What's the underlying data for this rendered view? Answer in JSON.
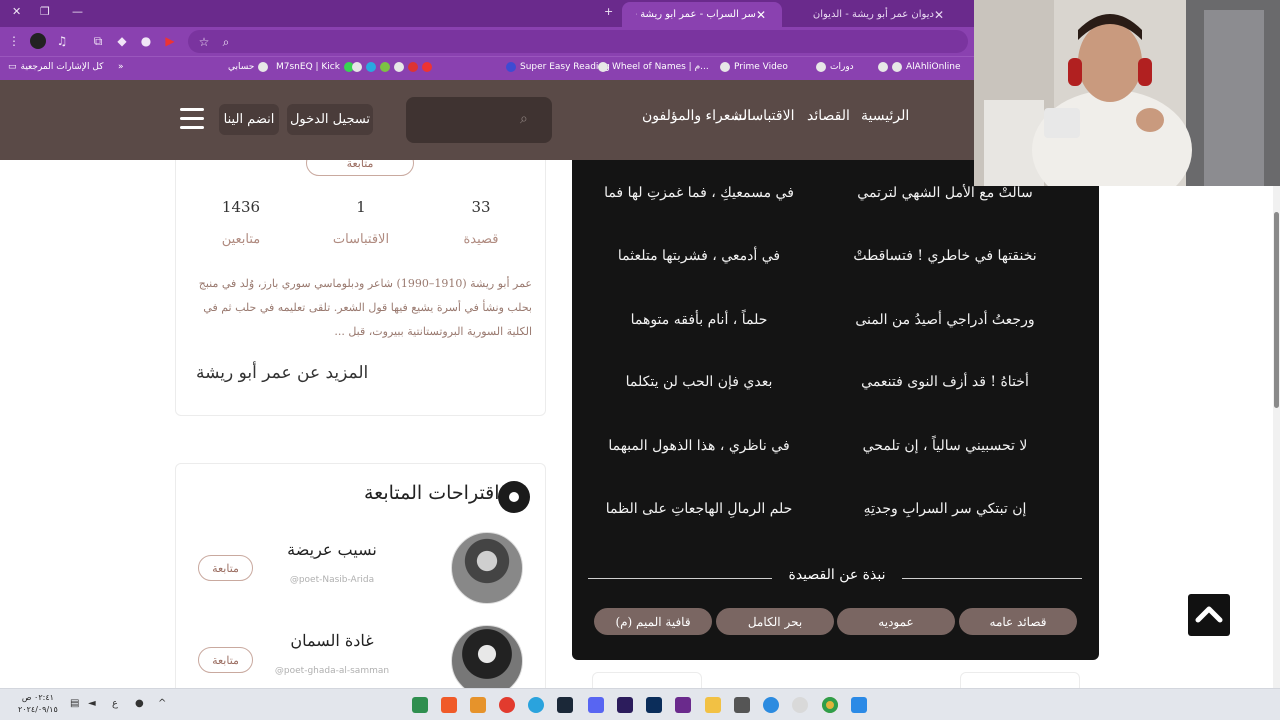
{
  "browser": {
    "tabs": [
      {
        "title": "ديوان عمر أبو ريشة - الديوان"
      },
      {
        "title": "سر السراب - عمر أبو ريشة - الديوان"
      }
    ],
    "bookmarks": [
      "AlAhliOnline",
      "دورات",
      "Prime Video",
      "Wheel of Names | م...",
      "Super Easy Reading",
      "M7snEQ | Kick",
      "حسابي",
      "كل الإشارات المرجعية"
    ]
  },
  "nav": {
    "links": [
      "الرئيسية",
      "القصائد",
      "الاقتباسات",
      "الشعراء والمؤلفون"
    ],
    "login": "تسجيل الدخول",
    "join": "انضم الينا"
  },
  "poet_card": {
    "follow_label": "متابعة",
    "stats": [
      {
        "value": "33",
        "label": "قصيدة"
      },
      {
        "value": "1",
        "label": "الاقتباسات"
      },
      {
        "value": "1436",
        "label": "متابعين"
      }
    ],
    "bio": "عمر أبو ريشة (1910–1990) شاعر ودبلوماسي سوري بارز، وُلد في منبج بحلب ونشأ في أسرة يشيع فيها قول الشعر. تلقى تعليمه في حلب ثم في الكلية السورية البروتستانتية ببيروت، قبل ...",
    "more": "المزيد عن عمر أبو ريشة"
  },
  "suggestions": {
    "title": "اقتراحات المتابعة",
    "items": [
      {
        "name": "نسيب عريضة",
        "handle": "@poet-Nasib-Arida",
        "follow": "متابعة"
      },
      {
        "name": "غادة السمان",
        "handle": "@poet-ghada-al-samman",
        "follow": "متابعة"
      }
    ]
  },
  "poem": {
    "verses": [
      {
        "right": "سالتْ مع الأمل الشهي لترتمي",
        "left": "في مسمعيكِ ، فما غمزتِ لها فما"
      },
      {
        "right": "نخنقتها في خاطري ! فتساقطتْ",
        "left": "في أدمعي ، فشربتها متلعثما"
      },
      {
        "right": "ورجعتُ أدراجي أصيدُ من المنى",
        "left": "حلماً ، أنام بأفقه متوهما"
      },
      {
        "right": "أختاهُ ! قد أزف النوى فتنعمي",
        "left": "بعدي فإن الحب لن يتكلما"
      },
      {
        "right": "لا تحسبيني سالياً ، إن تلمحي",
        "left": "في ناظري ، هذا الذهول المبهما"
      },
      {
        "right": "إن تبتكي سر السرابِ وجدتِهِ",
        "left": "حلم الرمالِ الهاجعاتِ على الظما"
      }
    ],
    "about_title": "نبذة عن القصيدة",
    "tags": [
      "قصائد عامه",
      "عموديه",
      "بحر الكامل",
      "قافية الميم (م)"
    ]
  },
  "taskbar": {
    "time": "٠٢:٤١ ص",
    "date": "٢٠٢٤/٠٩/١٥",
    "lang": "ع"
  }
}
